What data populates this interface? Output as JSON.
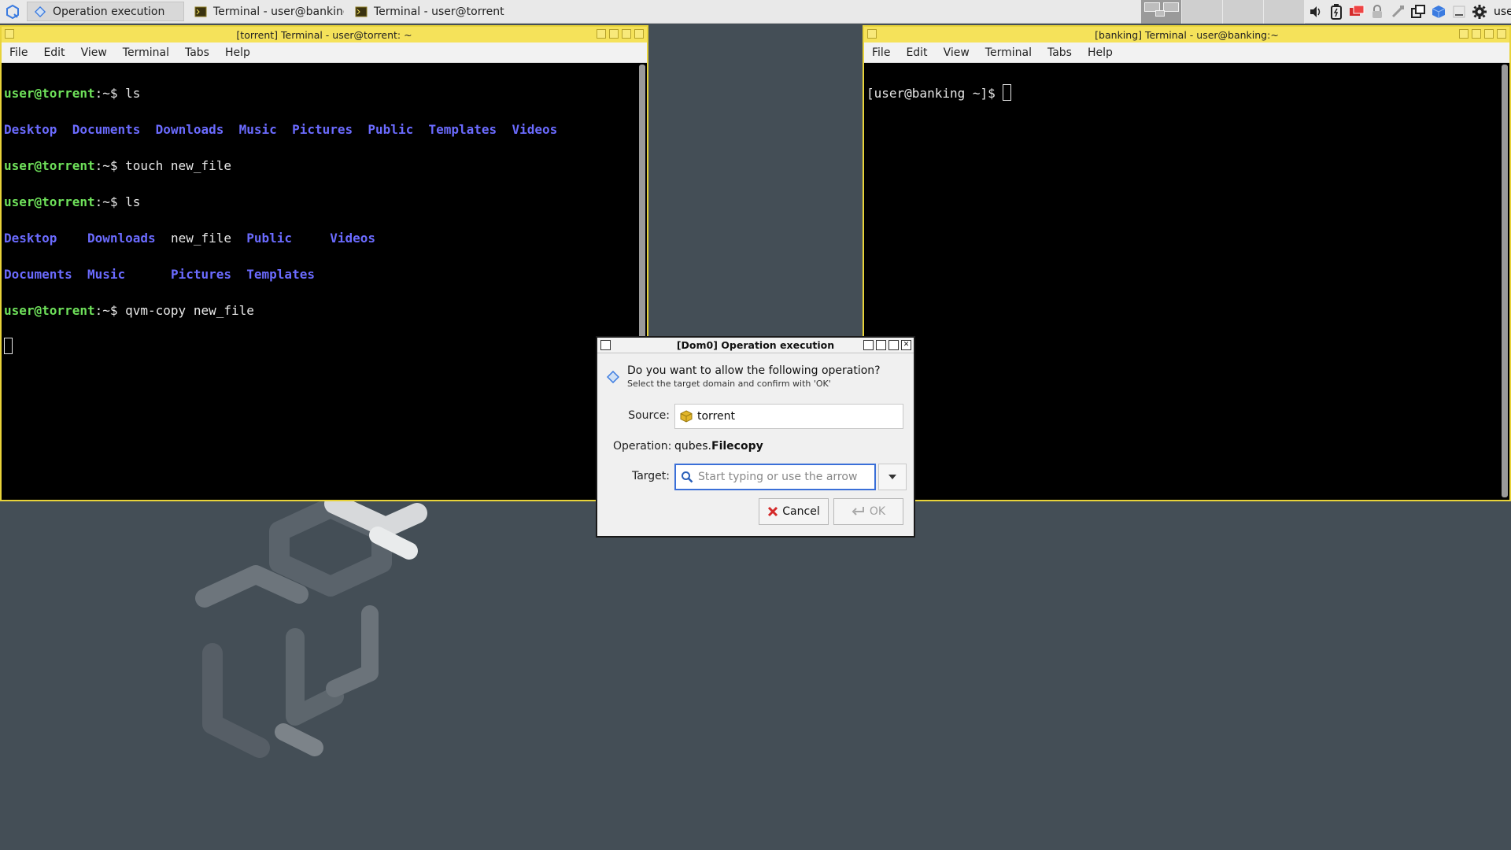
{
  "taskbar": {
    "tasks": [
      {
        "label": "Operation execution"
      },
      {
        "label": "Terminal - user@banking:~"
      },
      {
        "label": "Terminal - user@torrent: ~"
      }
    ],
    "user": "user"
  },
  "torrent_window": {
    "title": "[torrent] Terminal - user@torrent: ~",
    "menu": [
      "File",
      "Edit",
      "View",
      "Terminal",
      "Tabs",
      "Help"
    ],
    "prompt_user": "user@torrent",
    "prompt_path": ":~",
    "cmd1": "$ ls",
    "ls1": [
      "Desktop",
      "Documents",
      "Downloads",
      "Music",
      "Pictures",
      "Public",
      "Templates",
      "Videos"
    ],
    "cmd2": "$ touch new_file",
    "cmd3": "$ ls",
    "ls2_row1": [
      "Desktop",
      "Downloads",
      "new_file",
      "Public",
      "Videos"
    ],
    "ls2_row2": [
      "Documents",
      "Music",
      "Pictures",
      "Templates"
    ],
    "cmd4": "$ qvm-copy new_file"
  },
  "banking_window": {
    "title": "[banking] Terminal - user@banking:~",
    "menu": [
      "File",
      "Edit",
      "View",
      "Terminal",
      "Tabs",
      "Help"
    ],
    "prompt": "[user@banking ~]$ "
  },
  "dialog": {
    "title": "[Dom0] Operation execution",
    "question": "Do you want to allow the following operation?",
    "subtext": "Select the target domain and confirm with 'OK'",
    "source_label": "Source:",
    "source_value": "torrent",
    "operation_label": "Operation:",
    "operation_prefix": "qubes.",
    "operation_name": "Filecopy",
    "target_label": "Target:",
    "target_placeholder": "Start typing or use the arrow",
    "cancel_label": "Cancel",
    "ok_label": "OK"
  },
  "colors": {
    "window_border": "#e8d33a",
    "titlebar": "#f5e25a",
    "prompt_green": "#6ee05a",
    "dir_blue": "#6b6bff",
    "desktop": "#444e56"
  }
}
